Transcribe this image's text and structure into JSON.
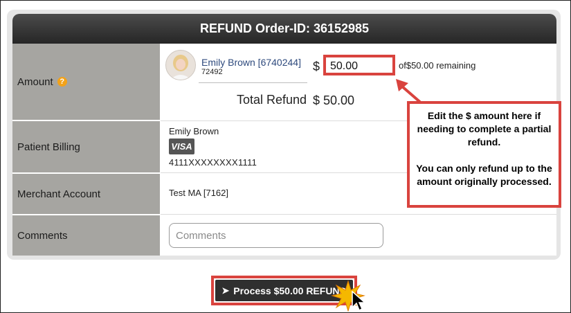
{
  "header": {
    "title": "REFUND Order-ID: 36152985"
  },
  "rows": {
    "amount_label": "Amount",
    "billing_label": "Patient Billing",
    "merchant_label": "Merchant Account",
    "comments_label": "Comments"
  },
  "amount": {
    "patient_link": "Emily Brown [6740244]",
    "patient_sub": "72492",
    "currency": "$",
    "input_value": "50.00",
    "remaining": "of$50.00 remaining",
    "total_label": "Total Refund",
    "total_value": "$ 50.00"
  },
  "billing": {
    "name": "Emily Brown",
    "card_brand": "VISA",
    "card_number": "4111XXXXXXXX1111"
  },
  "merchant": {
    "value": "Test MA [7162]"
  },
  "comments": {
    "placeholder": "Comments"
  },
  "callout": {
    "line1": "Edit the $ amount here if needing to complete a partial refund.",
    "line2": "You can only refund up to the amount originally processed."
  },
  "button": {
    "label": "Process $50.00 REFUND"
  },
  "colors": {
    "accent_red": "#d9433e",
    "header_dark": "#2f2f2f",
    "label_gray": "#a6a5a1",
    "help_orange": "#f2a21a"
  }
}
